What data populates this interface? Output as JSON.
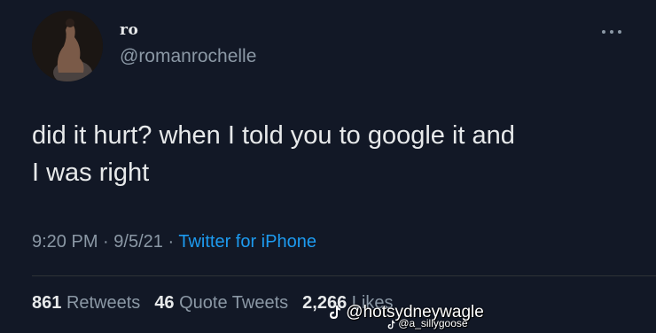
{
  "user": {
    "display_name": "ro",
    "handle": "@romanrochelle"
  },
  "tweet": {
    "text": "did it hurt? when I told you to google it and\nI was right",
    "time": "9:20 PM",
    "date": "9/5/21",
    "source": "Twitter for iPhone",
    "separator": "·"
  },
  "stats": {
    "retweets_count": "861",
    "retweets_label": "Retweets",
    "quotes_count": "46",
    "quotes_label": "Quote Tweets",
    "likes_count": "2,266",
    "likes_label": "Likes"
  },
  "watermark": {
    "primary": "@hotsydneywagle",
    "secondary": "@a_sillygoose"
  },
  "colors": {
    "background": "#121826",
    "text": "#e7e9ea",
    "secondary_text": "#8b98a5",
    "link": "#1d9bf0"
  },
  "icons": {
    "more": "more-horizontal-icon",
    "watermark": "tiktok-icon"
  }
}
